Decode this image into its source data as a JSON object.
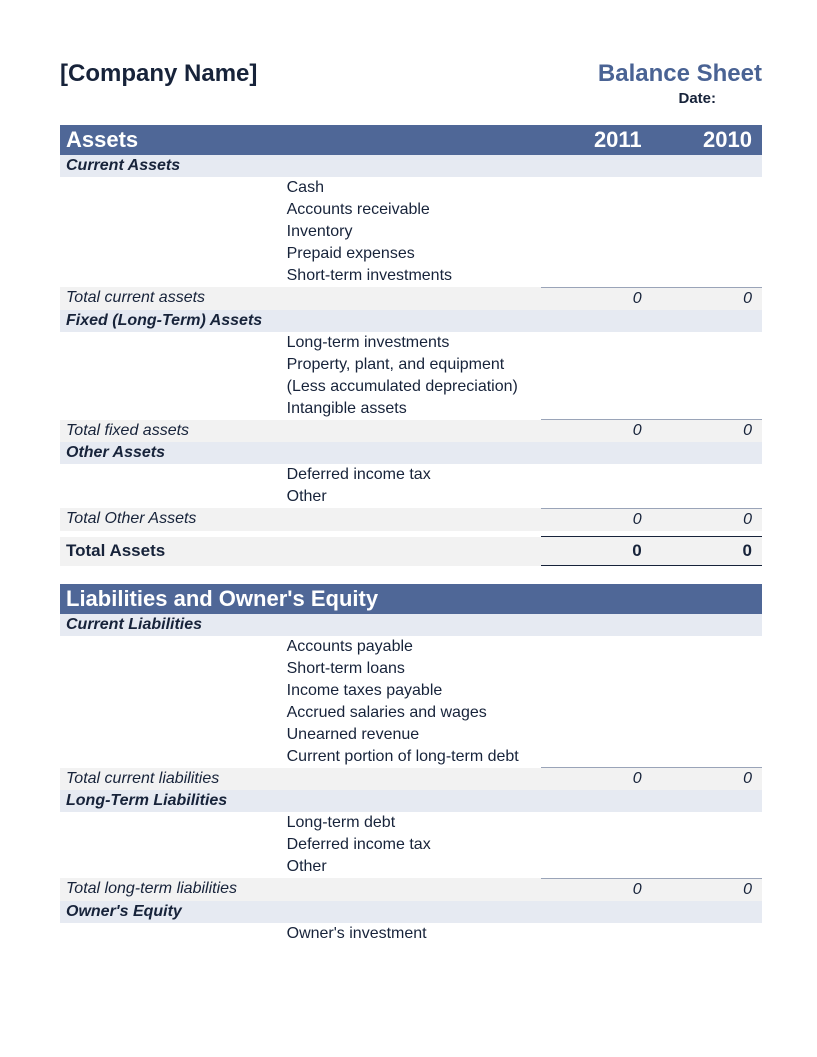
{
  "company_name": "[Company Name]",
  "title": "Balance Sheet",
  "date_label": "Date:",
  "year1": "2011",
  "year2": "2010",
  "assets": {
    "title": "Assets",
    "current": {
      "title": "Current Assets",
      "items": [
        "Cash",
        "Accounts receivable",
        "Inventory",
        "Prepaid expenses",
        "Short-term investments"
      ],
      "total_label": "Total current assets",
      "total_y1": "0",
      "total_y2": "0"
    },
    "fixed": {
      "title": "Fixed (Long-Term) Assets",
      "items": [
        "Long-term investments",
        "Property, plant, and equipment",
        "(Less accumulated depreciation)",
        "Intangible assets"
      ],
      "total_label": "Total fixed assets",
      "total_y1": "0",
      "total_y2": "0"
    },
    "other": {
      "title": "Other Assets",
      "items": [
        "Deferred income tax",
        "Other"
      ],
      "total_label": "Total Other Assets",
      "total_y1": "0",
      "total_y2": "0"
    },
    "grand_label": "Total Assets",
    "grand_y1": "0",
    "grand_y2": "0"
  },
  "liab": {
    "title": "Liabilities and Owner's Equity",
    "current": {
      "title": "Current Liabilities",
      "items": [
        "Accounts payable",
        "Short-term loans",
        "Income taxes payable",
        "Accrued salaries and wages",
        "Unearned revenue",
        "Current portion of long-term debt"
      ],
      "total_label": "Total current liabilities",
      "total_y1": "0",
      "total_y2": "0"
    },
    "longterm": {
      "title": "Long-Term Liabilities",
      "items": [
        "Long-term debt",
        "Deferred income tax",
        "Other"
      ],
      "total_label": "Total long-term liabilities",
      "total_y1": "0",
      "total_y2": "0"
    },
    "equity": {
      "title": "Owner's Equity",
      "items": [
        "Owner's investment"
      ]
    }
  }
}
